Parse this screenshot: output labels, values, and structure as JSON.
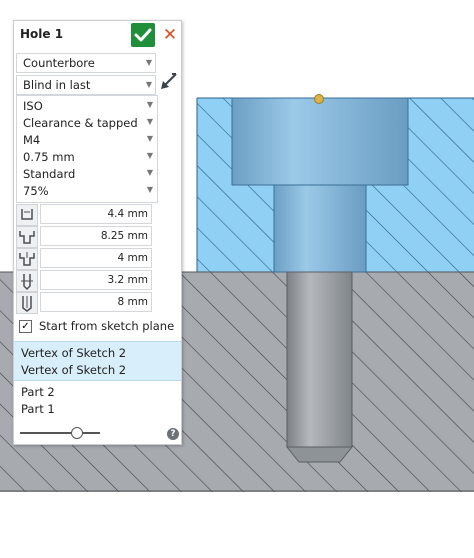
{
  "dialog": {
    "title": "Hole 1",
    "confirm_icon": "check-icon",
    "cancel_icon": "close-icon",
    "hole_style": "Counterbore",
    "termination": "Blind in last",
    "standard_group": [
      "ISO",
      "Clearance & tapped",
      "M4",
      "0.75 mm",
      "Standard",
      "75%"
    ],
    "dimensions": [
      {
        "icon": "counterbore-diameter-icon",
        "value": "4.4 mm"
      },
      {
        "icon": "counterbore-outer-diameter-icon",
        "value": "8.25 mm"
      },
      {
        "icon": "counterbore-depth-icon",
        "value": "4 mm"
      },
      {
        "icon": "tap-drill-diameter-icon",
        "value": "3.2 mm"
      },
      {
        "icon": "hole-depth-icon",
        "value": "8 mm"
      }
    ],
    "start_from_sketch_plane": {
      "checked": true,
      "label": "Start from sketch plane"
    },
    "selections": [
      "Vertex of Sketch 2",
      "Vertex of Sketch 2"
    ],
    "parts": [
      "Part 2",
      "Part 1"
    ],
    "slider_fraction": 0.7,
    "help_glyph": "?"
  },
  "colors": {
    "part_top": "#8fd0f4",
    "part_bottom": "#a7abb0",
    "bore": "#7aaed2",
    "shaft": "#9ea3a8",
    "accent_ok": "#1f8f3a",
    "cancel": "#d94c1f",
    "selection": "#d8eefa",
    "vertex": "#d9b24a"
  }
}
